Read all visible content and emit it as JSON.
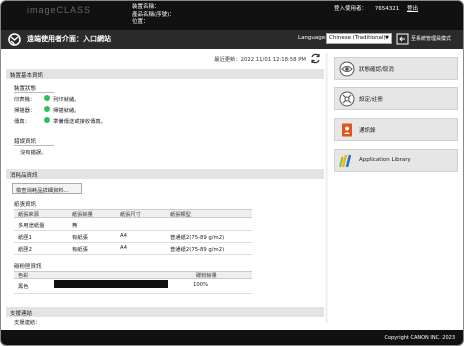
{
  "header": {
    "brand": "imageCLASS",
    "device_name_label": "装置名稱：",
    "product_name_label": "產品名稱(序號)：",
    "location_label": "位置：",
    "login_user_label": "登入使用者：",
    "login_user_value": "7654321",
    "logout_label": "登出"
  },
  "titlebar": {
    "title": "遠端使用者介面：入口網站",
    "language_label": "Language:",
    "language_value": "Chinese (Traditional)",
    "back_admin_label": "至系統管理員模式"
  },
  "updated": {
    "text": "最近更新：2022 11/01 12:18:58 PM"
  },
  "device_status": {
    "section_title": "裝置基本資訊",
    "sub_title": "裝置狀態",
    "rows": [
      {
        "label": "印表機：",
        "value": "列印就緒。"
      },
      {
        "label": "掃描器：",
        "value": "掃描就緒。"
      },
      {
        "label": "傳真：",
        "value": "準備傳送或接收傳真。"
      }
    ],
    "error_title": "錯誤資訊",
    "error_value": "沒有錯誤。"
  },
  "consumables": {
    "section_title": "消耗品資訊",
    "check_button": "檢查消耗品詳細資料...",
    "paper_title": "紙張資訊",
    "paper_headers": [
      "紙張來源",
      "紙張餘量",
      "紙張尺寸",
      "紙張類型"
    ],
    "paper_rows": [
      {
        "source": "多用途紙盤",
        "level": "無",
        "size": "",
        "type": ""
      },
      {
        "source": "紙匣1",
        "level": "有紙張",
        "size": "A4",
        "type": "普通紙2(75-89 g/m2)"
      },
      {
        "source": "紙匣2",
        "level": "有紙張",
        "size": "A4",
        "type": "普通紙2(75-89 g/m2)"
      }
    ],
    "toner_title": "碳粉匣資訊",
    "toner_headers": [
      "色彩",
      "碳粉餘量"
    ],
    "toner_rows": [
      {
        "color": "黑色",
        "level_text": "100%",
        "level": 1.0
      }
    ]
  },
  "support": {
    "section_title": "支援連結",
    "row_label": "支援連結："
  },
  "side_menu": [
    {
      "label": "狀態確認/取消",
      "icon": "eye-icon"
    },
    {
      "label": "設定/註冊",
      "icon": "settings-tool-icon"
    },
    {
      "label": "通訊錄",
      "icon": "address-book-icon"
    },
    {
      "label": "Application Library",
      "icon": "application-library-icon"
    }
  ],
  "footer": {
    "copyright": "Copyright CANON INC. 2023"
  },
  "colors": {
    "status_ready": "#2ec15a",
    "header_bg": "#111111",
    "titlebar_bg": "#2b2b2b",
    "address_book_orange": "#e2541a"
  }
}
